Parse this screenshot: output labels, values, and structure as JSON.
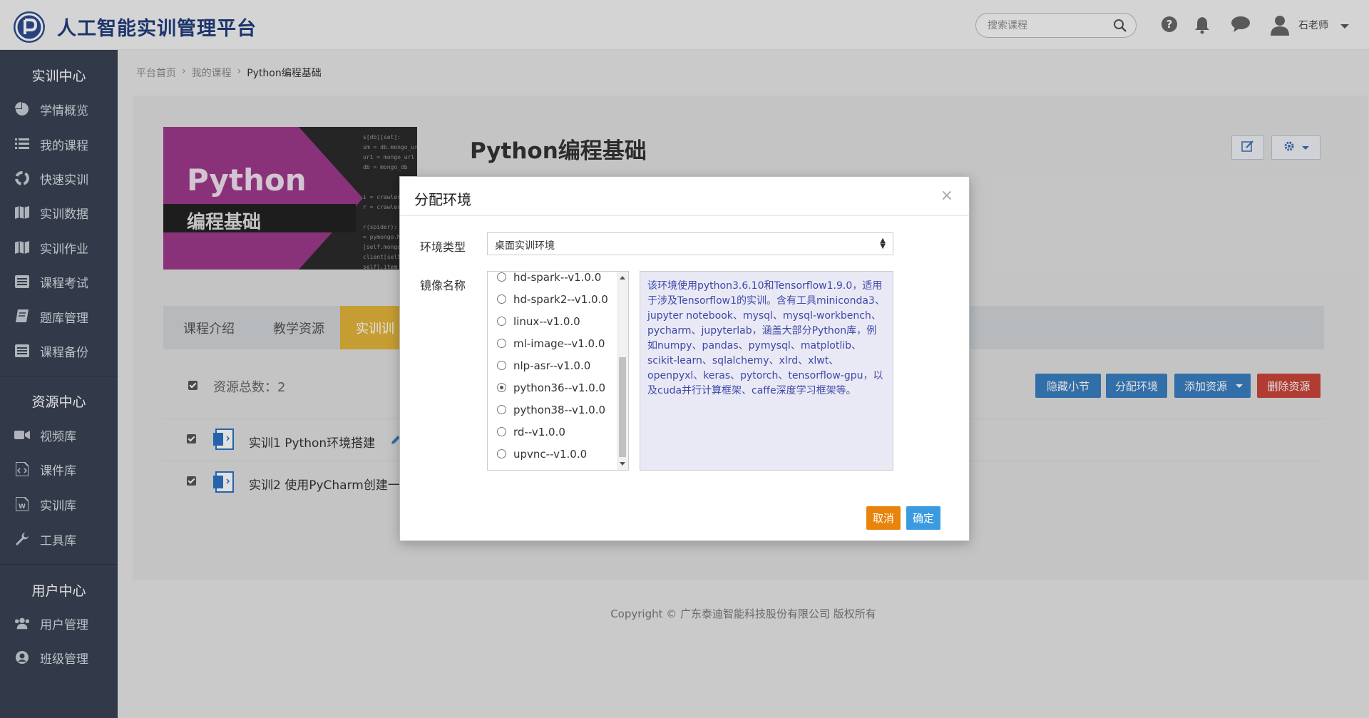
{
  "app": {
    "title": "人工智能实训管理平台",
    "search_placeholder": "搜索课程",
    "user_name": "石老师"
  },
  "sidebar": {
    "sections": [
      {
        "title": "实训中心",
        "items": [
          {
            "label": "学情概览",
            "icon": "pie-chart-icon"
          },
          {
            "label": "我的课程",
            "icon": "list-icon"
          },
          {
            "label": "快速实训",
            "icon": "recycle-icon"
          },
          {
            "label": "实训数据",
            "icon": "map-icon"
          },
          {
            "label": "实训作业",
            "icon": "map-icon"
          },
          {
            "label": "课程考试",
            "icon": "list-alt-icon"
          },
          {
            "label": "题库管理",
            "icon": "book-icon"
          },
          {
            "label": "课程备份",
            "icon": "list-alt-icon"
          }
        ]
      },
      {
        "title": "资源中心",
        "items": [
          {
            "label": "视频库",
            "icon": "video-camera-icon"
          },
          {
            "label": "课件库",
            "icon": "file-code-icon"
          },
          {
            "label": "实训库",
            "icon": "file-word-icon"
          },
          {
            "label": "工具库",
            "icon": "wrench-icon"
          }
        ]
      },
      {
        "title": "用户中心",
        "items": [
          {
            "label": "用户管理",
            "icon": "users-icon"
          },
          {
            "label": "班级管理",
            "icon": "user-circle-icon"
          }
        ]
      }
    ]
  },
  "breadcrumb": [
    "平台首页",
    "我的课程",
    "Python编程基础"
  ],
  "course": {
    "title": "Python编程基础",
    "cover_title": "Python",
    "cover_subtitle": "编程基础"
  },
  "tabs": [
    "课程介绍",
    "教学资源",
    "实训训"
  ],
  "resources": {
    "total_label": "资源总数：2",
    "buttons": {
      "hide_section": "隐藏小节",
      "assign_env": "分配环境",
      "add_resource": "添加资源",
      "delete_resource": "删除资源"
    },
    "rows": [
      "实训1 Python环境搭建",
      "实训2 使用PyCharm创建一"
    ]
  },
  "footer": "Copyright © 广东泰迪智能科技股份有限公司 版权所有",
  "modal": {
    "title": "分配环境",
    "close": "×",
    "env_type_label": "环境类型",
    "env_type_value": "桌面实训环境",
    "image_name_label": "镜像名称",
    "images": [
      {
        "label": "hd-spark--v1.0.0",
        "selected": false
      },
      {
        "label": "hd-spark2--v1.0.0",
        "selected": false
      },
      {
        "label": "linux--v1.0.0",
        "selected": false
      },
      {
        "label": "ml-image--v1.0.0",
        "selected": false
      },
      {
        "label": "nlp-asr--v1.0.0",
        "selected": false
      },
      {
        "label": "python36--v1.0.0",
        "selected": true
      },
      {
        "label": "python38--v1.0.0",
        "selected": false
      },
      {
        "label": "rd--v1.0.0",
        "selected": false
      },
      {
        "label": "upvnc--v1.0.0",
        "selected": false
      }
    ],
    "description": "该环境使用python3.6.10和Tensorflow1.9.0，适用于涉及Tensorflow1的实训。含有工具miniconda3、jupyter notebook、mysql、mysql-workbench、pycharm、jupyterlab，涵盖大部分Python库，例如numpy、pandas、pymysql、matplotlib、scikit-learn、sqlalchemy、xlrd、xlwt、openpyxl、keras、pytorch、tensorflow-gpu，以及cuda并行计算框架、caffe深度学习框架等。",
    "cancel": "取消",
    "confirm": "确定"
  },
  "colors": {
    "sidebar_bg": "#3a4254",
    "brand": "#223d7c",
    "tab_active": "#e2b33b",
    "btn_blue": "#3a7fc1",
    "btn_red": "#c9453a",
    "btn_orange": "#e8830c",
    "btn_light_blue": "#3a9be0"
  }
}
